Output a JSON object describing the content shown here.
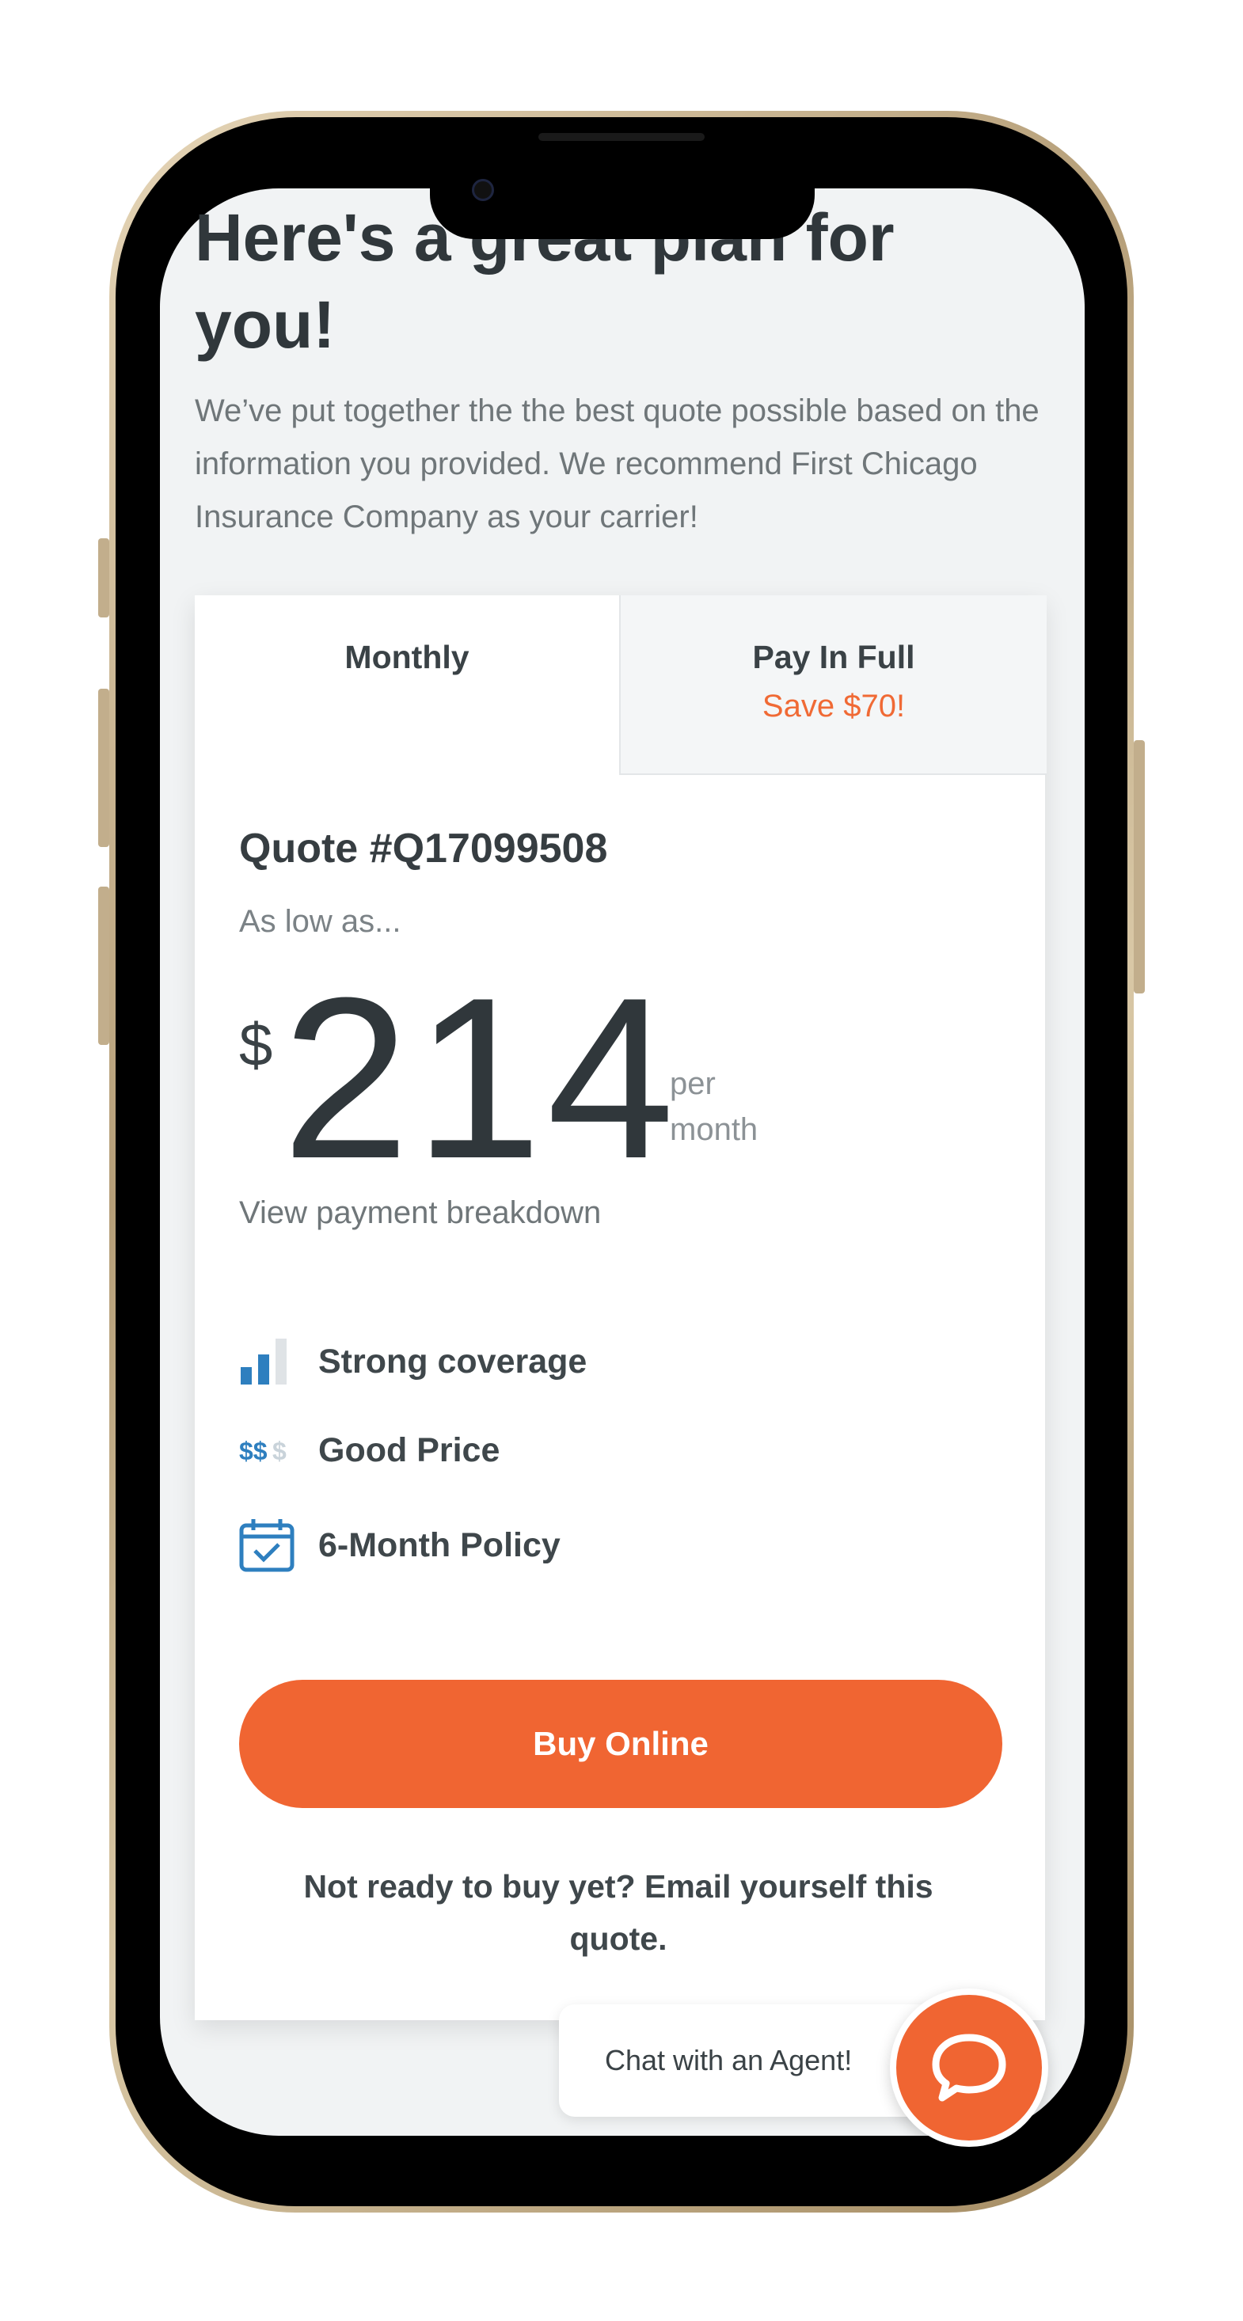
{
  "hero": {
    "title": "Here's a great plan for you!",
    "description": "We’ve put together the the best quote possible based on the information you provided. We recommend First Chicago Insurance Company as your carrier!"
  },
  "tabs": {
    "monthly": "Monthly",
    "pay_in_full": "Pay In Full",
    "pay_in_full_savings": "Save $70!"
  },
  "quote": {
    "number": "Quote #Q17099508",
    "as_low_as": "As low as...",
    "currency": "$",
    "amount": "214",
    "period_line1": "per",
    "period_line2": "month",
    "breakdown_link": "View payment breakdown"
  },
  "features": [
    {
      "icon": "signal-bars-icon",
      "label": "Strong coverage"
    },
    {
      "icon": "dollar-signs-icon",
      "label": "Good Price"
    },
    {
      "icon": "calendar-check-icon",
      "label": "6-Month Policy"
    }
  ],
  "actions": {
    "buy_label": "Buy Online",
    "email_label": "Not ready to buy yet? Email yourself this quote."
  },
  "chat": {
    "label": "Chat with an Agent!"
  },
  "colors": {
    "accent": "#f06532",
    "icon_blue": "#2e7fbf",
    "text_dark": "#30373b"
  }
}
